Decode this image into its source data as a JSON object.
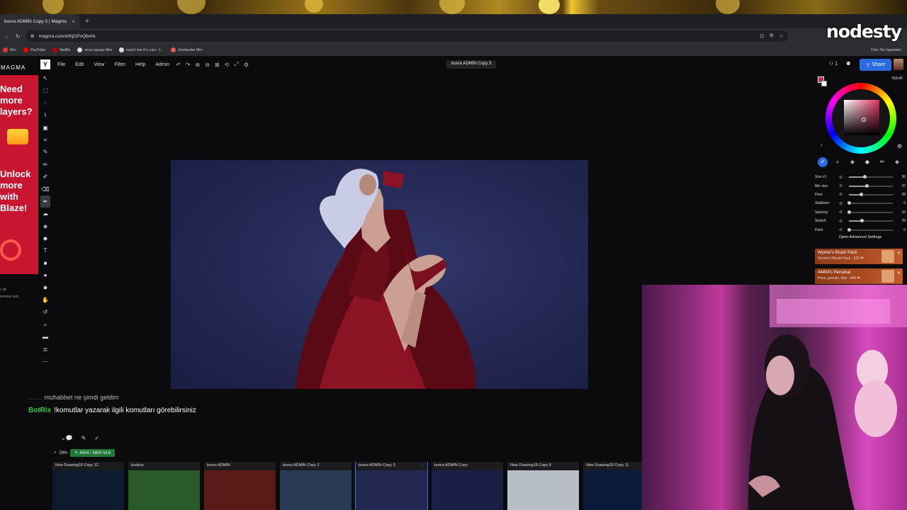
{
  "browser": {
    "tab_title": "busra ADMİN Copy 3 | Magma",
    "url": "magma.com/d/KjGPvQbvhk",
    "bookmarks": [
      "film",
      "YouTube",
      "Netflix",
      "onur savaşı film",
      "mach me if u can - f...",
      "Zoolander film"
    ],
    "all_bookmarks": "Tüm Yer İşaretleri",
    "overlay_logo": "nodesty"
  },
  "ad": {
    "brand": "MAGMA",
    "lines_top": [
      "Need",
      "more",
      "layers?"
    ],
    "lines_bottom": [
      "Unlock",
      "more",
      "with",
      "Blaze!"
    ],
    "remove_line1": "□ ⊠",
    "remove_line2": "remove ads"
  },
  "app": {
    "menu": [
      "File",
      "Edit",
      "View",
      "Filter",
      "Help",
      "Admin"
    ],
    "document_title": "busra ADMİN Copy 3",
    "users_count": "1",
    "share_label": "Share"
  },
  "color": {
    "hex": "7b3c4f",
    "accent": "#2a6ce0",
    "primary": "#c42a55"
  },
  "sliders": [
    {
      "label": "Size x1",
      "value": "36",
      "fraction": 0.35
    },
    {
      "label": "Min size",
      "value": "37",
      "fraction": 0.4
    },
    {
      "label": "Flow",
      "value": "28",
      "fraction": 0.28
    },
    {
      "label": "Stabilizer",
      "value": "0",
      "fraction": 0
    },
    {
      "label": "Spacing",
      "value": "10",
      "fraction": 0
    },
    {
      "label": "Stretch",
      "value": "29",
      "fraction": 0.29
    },
    {
      "label": "Paint",
      "value": "0",
      "fraction": 0
    }
  ],
  "advanced": "Open Advanced Settings",
  "packs": [
    {
      "name": "Wynter's Brush Pack",
      "sub": "Wynter's Brush Pack · 525 ❤"
    },
    {
      "name": "44404's Personal",
      "sub": "Pens, pencils, inks · 444 ❤"
    }
  ],
  "chat": {
    "line1_user": "........",
    "line1_text": "muhabbet ne şimdi geldim",
    "bot_name": "BotRix",
    "bot_text": "!komutlar yazarak ilgili komutları görebilirsiniz"
  },
  "status": {
    "zoom": "29%",
    "xp": "4404 / 4800",
    "level": "lvl 6"
  },
  "drawings": [
    {
      "title": "New Drawing18 Copy 12",
      "color": "#0e1a2e"
    },
    {
      "title": "busbus",
      "color": "#2a5a2a"
    },
    {
      "title": "busra ADMİN",
      "color": "#5a1a18"
    },
    {
      "title": "busra ADMİN Copy 2",
      "color": "#2a3a55"
    },
    {
      "title": "busra ADMİN Copy 3",
      "color": "#232850"
    },
    {
      "title": "busra ADMİN Copy",
      "color": "#1a2045"
    },
    {
      "title": "New Drawing18 Copy 8",
      "color": "#b8bec8"
    },
    {
      "title": "New Drawing18 Copy 11",
      "color": "#0c1a3a"
    }
  ]
}
